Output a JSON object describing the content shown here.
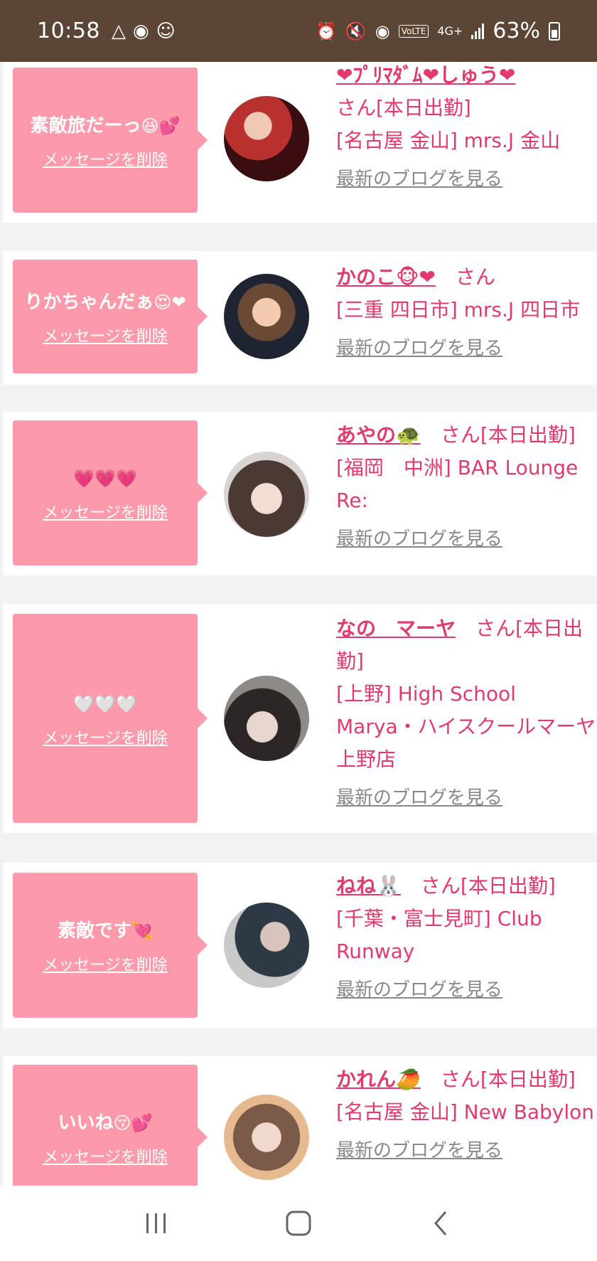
{
  "status_bar": {
    "time": "10:58",
    "network": "4G+",
    "volte": "VoLTE",
    "battery": "63%",
    "icons": [
      "notification-icon",
      "face-app-icon",
      "face-smile-icon",
      "alarm-icon",
      "mute-icon",
      "location-icon"
    ]
  },
  "common": {
    "delete_label": "メッセージを削除",
    "blog_label": "最新のブログを見る"
  },
  "cards": [
    {
      "message": "素敵旅だーっ",
      "message_emoji": "😆💕",
      "name": "❤ﾌﾟﾘﾏﾀﾞﾑ❤しゅう❤",
      "suffix": "さん[本日出勤]",
      "shop": "[名古屋 金山] mrs.J 金山"
    },
    {
      "message": "りかちゃんだぁ",
      "message_emoji": "😍❤",
      "name": "かのこ🐵❤",
      "suffix": "さん",
      "shop": "[三重 四日市] mrs.J 四日市"
    },
    {
      "message": "",
      "message_emoji": "💗💗💗",
      "name": "あやの🐢",
      "suffix": "さん[本日出勤]",
      "shop": "[福岡　中洲] BAR Lounge Re:"
    },
    {
      "message": "",
      "message_emoji": "🤍🤍🤍",
      "name": "なの　マーヤ",
      "suffix": "さん[本日出勤]",
      "shop": "[上野] High School Marya・ハイスクールマーヤ上野店"
    },
    {
      "message": "素敵です",
      "message_emoji": "💘",
      "name": "ねね🐰",
      "suffix": "さん[本日出勤]",
      "shop": "[千葉・富士見町] Club Runway"
    },
    {
      "message": "いいね",
      "message_emoji": "😚💕",
      "name": "かれん🥭",
      "suffix": "さん[本日出勤]",
      "shop": "[名古屋 金山] New Babylon"
    }
  ],
  "colors": {
    "status_bar": "#5b4636",
    "bubble": "#fc9aab",
    "accent_text": "#e4396c",
    "link_grey": "#888888"
  }
}
